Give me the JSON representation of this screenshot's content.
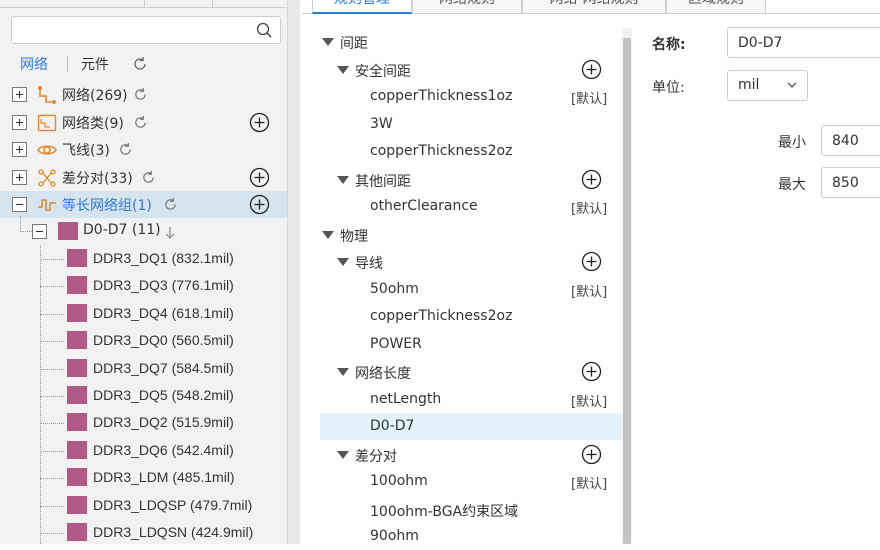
{
  "left": {
    "search": {
      "placeholder": "",
      "value": ""
    },
    "subtabs": {
      "network": "网络",
      "component": "元件"
    },
    "groups": [
      {
        "label": "网络(269)",
        "icon": "net-icon",
        "expanded": false,
        "has_add": false
      },
      {
        "label": "网络类(9)",
        "icon": "net-class-icon",
        "expanded": false,
        "has_add": true
      },
      {
        "label": "飞线(3)",
        "icon": "eye-icon",
        "expanded": false,
        "has_add": false
      },
      {
        "label": "差分对(33)",
        "icon": "diff-pair-icon",
        "expanded": false,
        "has_add": true
      },
      {
        "label": "等长网络组(1)",
        "icon": "equal-length-icon",
        "expanded": true,
        "has_add": true,
        "selected": true
      }
    ],
    "group_item": {
      "label": "D0-D7 (11)",
      "sort_icon": "arrow-down-icon"
    },
    "nets": [
      "DDR3_DQ1 (832.1mil)",
      "DDR3_DQ3 (776.1mil)",
      "DDR3_DQ4 (618.1mil)",
      "DDR3_DQ0 (560.5mil)",
      "DDR3_DQ7 (584.5mil)",
      "DDR3_DQ5 (548.2mil)",
      "DDR3_DQ2 (515.9mil)",
      "DDR3_DQ6 (542.4mil)",
      "DDR3_LDM (485.1mil)",
      "DDR3_LDQSP (479.7mil)",
      "DDR3_LDQSN (424.9mil)"
    ],
    "swatch_color": "#b05886"
  },
  "tabs": [
    "规则管理",
    "网络规则",
    "网络-网络规则",
    "区域规则"
  ],
  "rules": {
    "default_text": "[默认]",
    "rows": [
      {
        "level": 0,
        "label": "间距"
      },
      {
        "level": 1,
        "label": "安全间距",
        "add": true
      },
      {
        "level": 2,
        "label": "copperThickness1oz",
        "default": true
      },
      {
        "level": 2,
        "label": "3W"
      },
      {
        "level": 2,
        "label": "copperThickness2oz"
      },
      {
        "level": 1,
        "label": "其他间距",
        "add": true
      },
      {
        "level": 2,
        "label": "otherClearance",
        "default": true
      },
      {
        "level": 0,
        "label": "物理"
      },
      {
        "level": 1,
        "label": "导线",
        "add": true
      },
      {
        "level": 2,
        "label": "50ohm",
        "default": true
      },
      {
        "level": 2,
        "label": "copperThickness2oz"
      },
      {
        "level": 2,
        "label": "POWER"
      },
      {
        "level": 1,
        "label": "网络长度",
        "add": true
      },
      {
        "level": 2,
        "label": "netLength",
        "default": true
      },
      {
        "level": 2,
        "label": "D0-D7",
        "selected": true
      },
      {
        "level": 1,
        "label": "差分对",
        "add": true
      },
      {
        "level": 2,
        "label": "100ohm",
        "default": true
      },
      {
        "level": 2,
        "label": "100ohm-BGA约束区域"
      },
      {
        "level": 2,
        "label": "90ohm"
      }
    ]
  },
  "props": {
    "name_label": "名称:",
    "name_value": "D0-D7",
    "unit_label": "单位:",
    "unit_value": "mil",
    "min_label": "最小",
    "min_value": "840",
    "max_label": "最大",
    "max_value": "850"
  },
  "colors": {
    "accent": "#2f7ad8",
    "add_icon": "#222222",
    "selected_row": "#e3f3fc",
    "selected_group": "#d5e4ef"
  }
}
